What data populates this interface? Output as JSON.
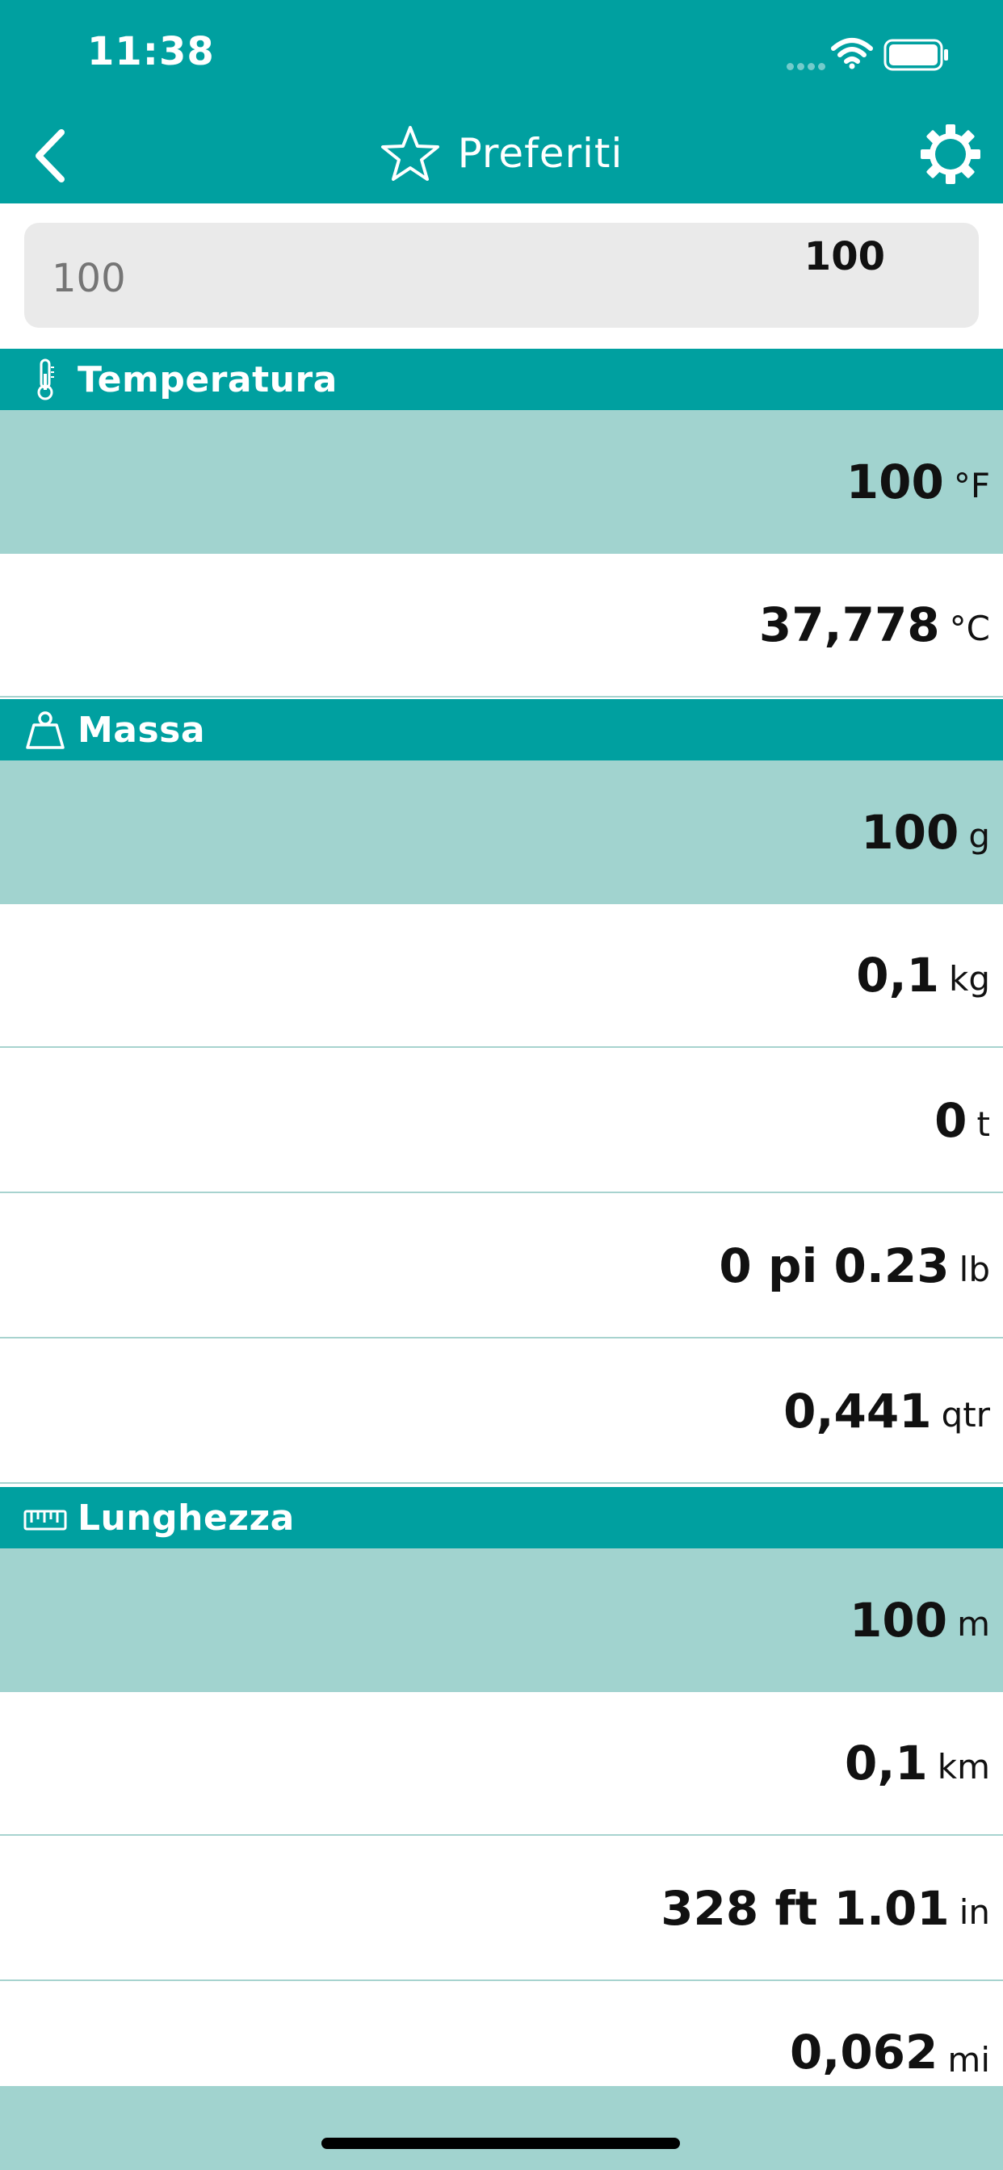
{
  "status": {
    "time": "11:38"
  },
  "nav": {
    "title": "Preferiti"
  },
  "search": {
    "placeholder": "100",
    "value": "100"
  },
  "sections": [
    {
      "title": "Temperatura",
      "icon": "thermometer-icon",
      "rows": [
        {
          "value": "100",
          "unit": "°F",
          "highlight": true
        },
        {
          "value": "37,778",
          "unit": "°C"
        }
      ]
    },
    {
      "title": "Massa",
      "icon": "weight-icon",
      "rows": [
        {
          "value": "100",
          "unit": "g",
          "highlight": true
        },
        {
          "value": "0,1",
          "unit": "kg"
        },
        {
          "value": "0",
          "unit": "t"
        },
        {
          "value": "0 pi 0.23",
          "unit": "lb"
        },
        {
          "value": "0,441",
          "unit": "qtr"
        }
      ]
    },
    {
      "title": "Lunghezza",
      "icon": "ruler-icon",
      "rows": [
        {
          "value": "100",
          "unit": "m",
          "highlight": true
        },
        {
          "value": "0,1",
          "unit": "km"
        },
        {
          "value": "328 ft 1.01",
          "unit": "in"
        },
        {
          "value": "0,062",
          "unit": "mi"
        }
      ]
    }
  ],
  "colors": {
    "accent": "#00a0a0",
    "highlight": "#a1d3cf",
    "field": "#eaeaea"
  }
}
